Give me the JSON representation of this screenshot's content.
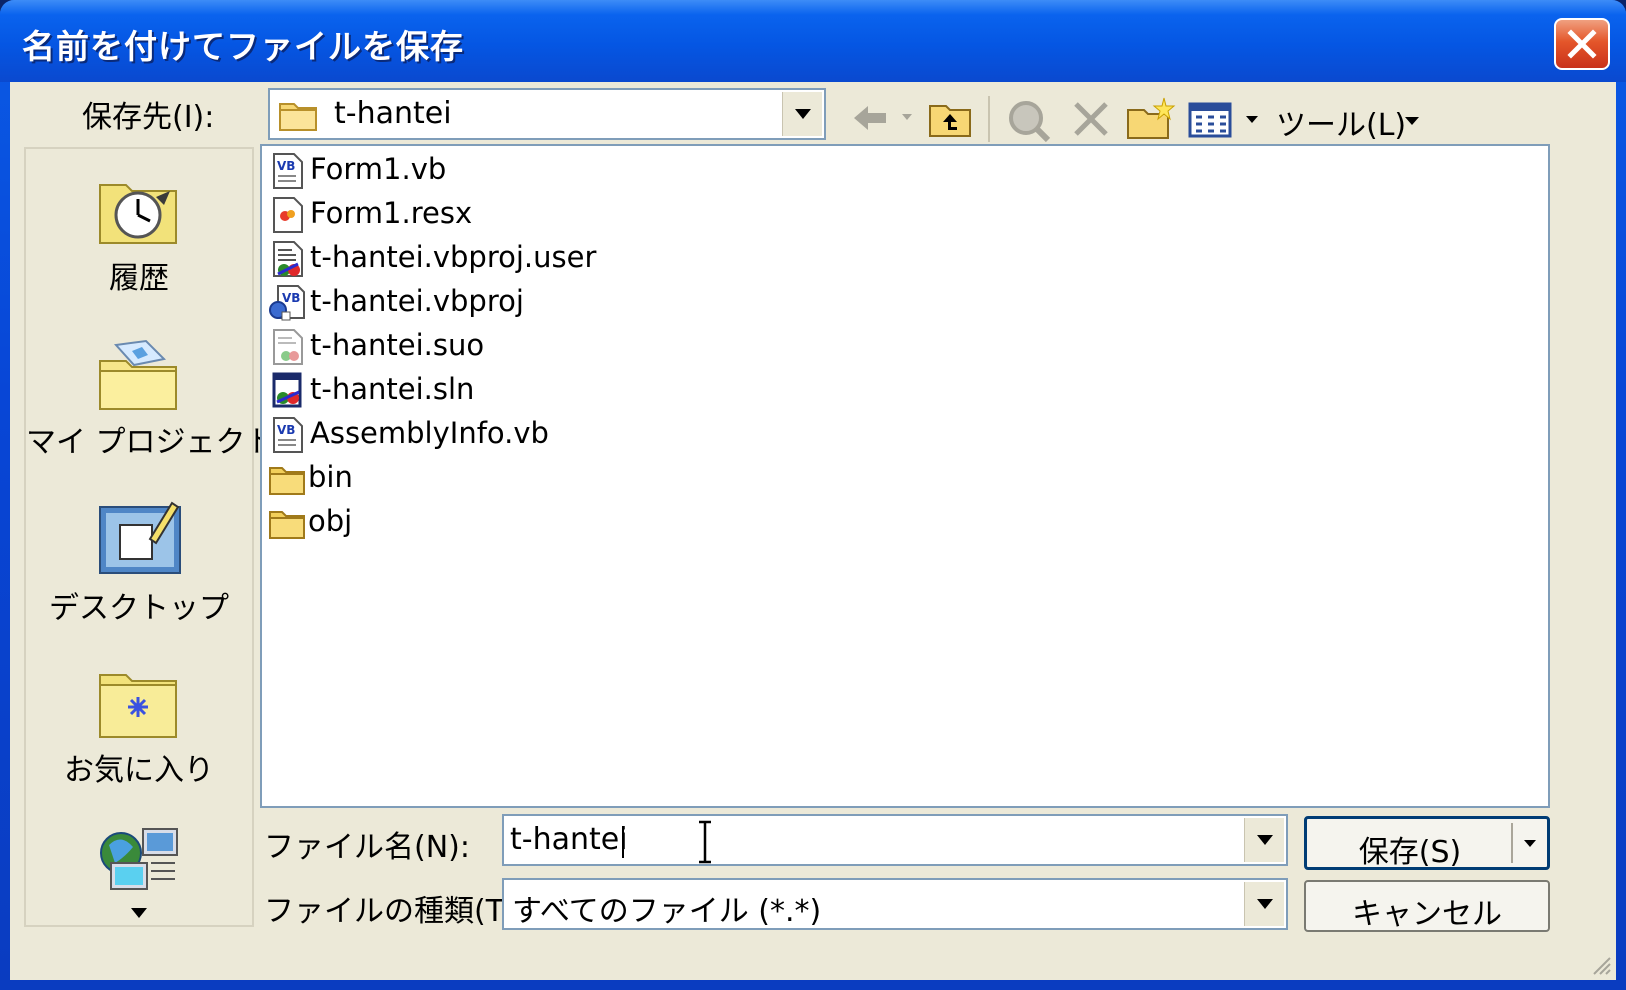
{
  "window": {
    "title": "名前を付けてファイルを保存"
  },
  "top": {
    "save_in_label": "保存先(I):",
    "location_value": "t-hantei",
    "tools_label": "ツール(L)"
  },
  "places": [
    {
      "label": "履歴"
    },
    {
      "label": "マイ プロジェクト"
    },
    {
      "label": "デスクトップ"
    },
    {
      "label": "お気に入り"
    }
  ],
  "files": [
    {
      "name": "Form1.vb",
      "icon": "vb-file-icon"
    },
    {
      "name": "Form1.resx",
      "icon": "resx-file-icon"
    },
    {
      "name": "t-hantei.vbproj.user",
      "icon": "vbproj-user-file-icon"
    },
    {
      "name": "t-hantei.vbproj",
      "icon": "vbproj-file-icon"
    },
    {
      "name": "t-hantei.suo",
      "icon": "suo-file-icon"
    },
    {
      "name": "t-hantei.sln",
      "icon": "sln-file-icon"
    },
    {
      "name": "AssemblyInfo.vb",
      "icon": "vb-file-icon"
    },
    {
      "name": "bin",
      "icon": "folder-icon"
    },
    {
      "name": "obj",
      "icon": "folder-icon"
    }
  ],
  "bottom": {
    "filename_label": "ファイル名(N):",
    "filename_value": "t-hantei",
    "filetype_label": "ファイルの種類(T):",
    "filetype_value": "すべてのファイル (*.*)",
    "save_button": "保存(S)",
    "cancel_button": "キャンセル"
  }
}
